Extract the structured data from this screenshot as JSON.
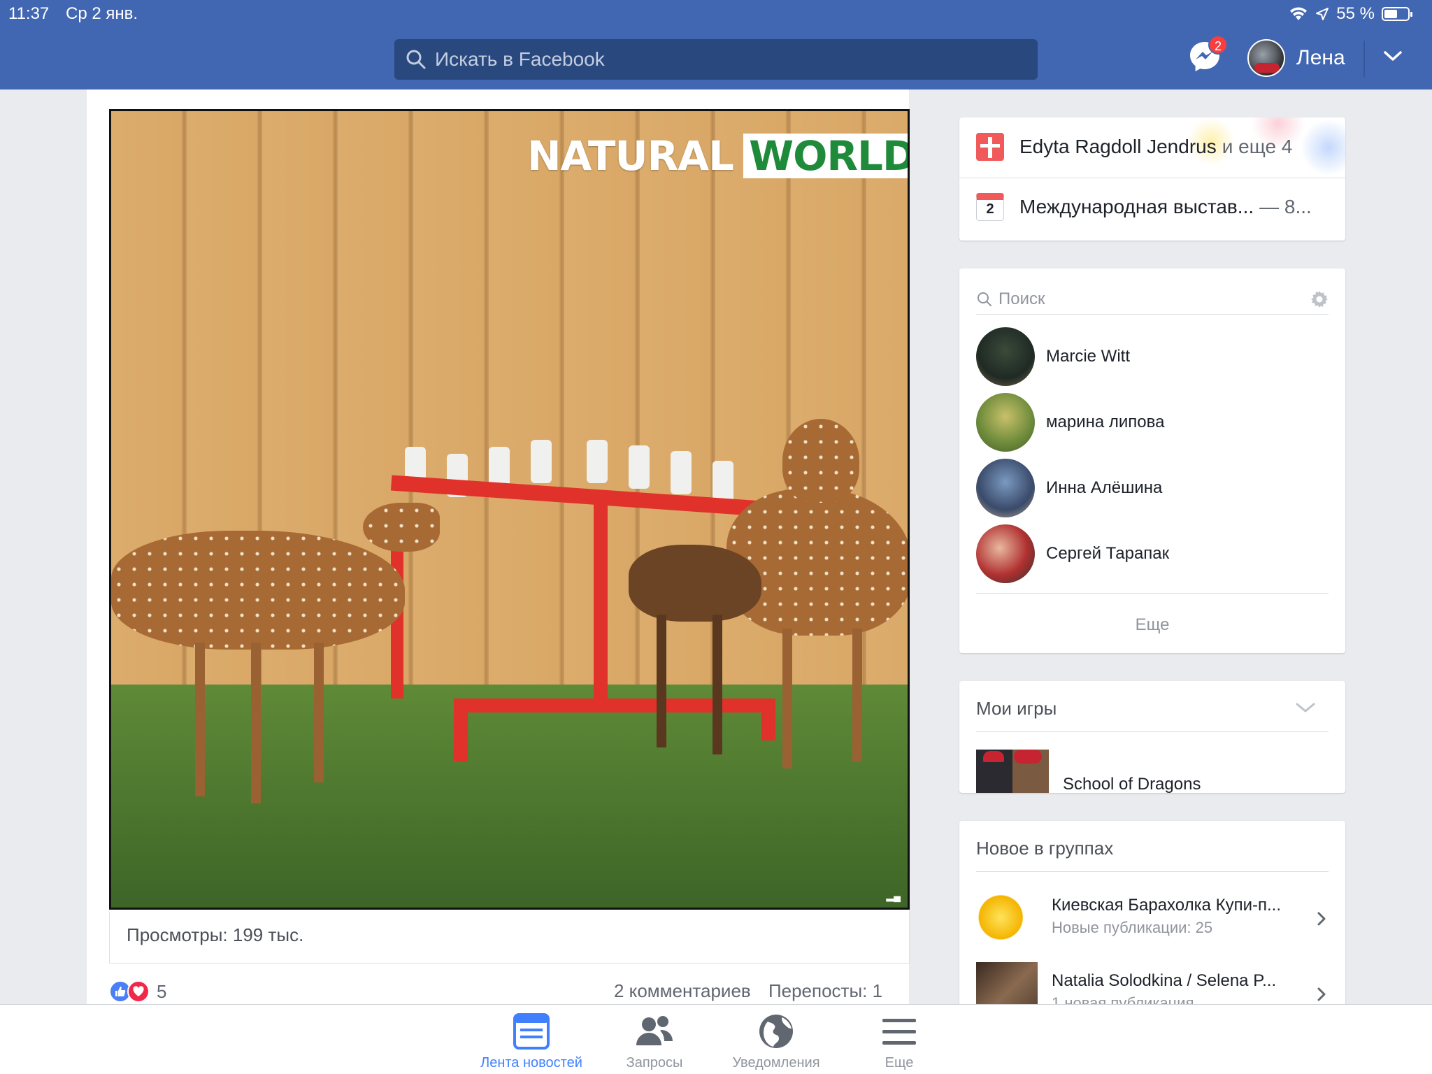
{
  "status": {
    "time": "11:37",
    "date": "Ср 2 янв.",
    "battery": "55 %",
    "battery_level": 0.55
  },
  "header": {
    "search_placeholder": "Искать в Facebook",
    "messenger_badge": "2",
    "user_name": "Лена"
  },
  "post": {
    "video_brand_left": "NATURAL",
    "video_brand_right": "WORLD",
    "views": "Просмотры: 199 тыс.",
    "reaction_count": "5",
    "comments": "2 комментариев",
    "shares": "Перепосты: 1"
  },
  "events": {
    "birthday_name": "Edyta Ragdoll Jendrus",
    "birthday_more": "и еще 4",
    "calendar_day": "2",
    "event_name": "Международная выстав...",
    "event_more": "— 8..."
  },
  "contacts": {
    "search_placeholder": "Поиск",
    "items": [
      {
        "name": "Marcie Witt"
      },
      {
        "name": "марина липова"
      },
      {
        "name": "Инна Алёшина"
      },
      {
        "name": "Сергей Тарапак"
      }
    ],
    "more": "Еще"
  },
  "games": {
    "title": "Мои игры",
    "items": [
      {
        "name": "School of Dragons"
      }
    ]
  },
  "groups": {
    "title": "Новое в группах",
    "items": [
      {
        "name": "Киевская Барахолка Купи-п...",
        "sub": "Новые публикации: 25"
      },
      {
        "name": "Natalia Solodkina / Selena P...",
        "sub": "1 новая публикация"
      }
    ]
  },
  "tabs": [
    {
      "label": "Лента новостей",
      "icon": "news-feed-icon",
      "active": true
    },
    {
      "label": "Запросы",
      "icon": "friend-requests-icon",
      "active": false
    },
    {
      "label": "Уведомления",
      "icon": "globe-icon",
      "active": false
    },
    {
      "label": "Еще",
      "icon": "menu-icon",
      "active": false
    }
  ],
  "colors": {
    "brand": "#4267b2",
    "active_tab": "#4080ff",
    "badge": "#fa3e3e"
  }
}
